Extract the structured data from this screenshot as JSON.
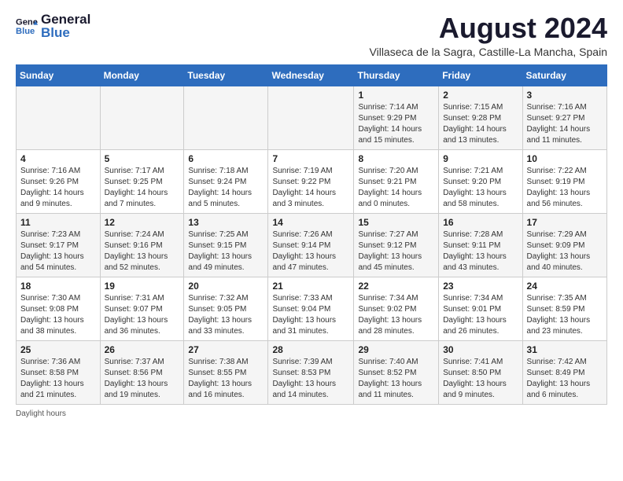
{
  "header": {
    "logo_line1": "General",
    "logo_line2": "Blue",
    "title": "August 2024",
    "subtitle": "Villaseca de la Sagra, Castille-La Mancha, Spain"
  },
  "days_of_week": [
    "Sunday",
    "Monday",
    "Tuesday",
    "Wednesday",
    "Thursday",
    "Friday",
    "Saturday"
  ],
  "footer": {
    "note": "Daylight hours"
  },
  "weeks": [
    {
      "days": [
        {
          "num": "",
          "info": ""
        },
        {
          "num": "",
          "info": ""
        },
        {
          "num": "",
          "info": ""
        },
        {
          "num": "",
          "info": ""
        },
        {
          "num": "1",
          "info": "Sunrise: 7:14 AM\nSunset: 9:29 PM\nDaylight: 14 hours\nand 15 minutes."
        },
        {
          "num": "2",
          "info": "Sunrise: 7:15 AM\nSunset: 9:28 PM\nDaylight: 14 hours\nand 13 minutes."
        },
        {
          "num": "3",
          "info": "Sunrise: 7:16 AM\nSunset: 9:27 PM\nDaylight: 14 hours\nand 11 minutes."
        }
      ]
    },
    {
      "days": [
        {
          "num": "4",
          "info": "Sunrise: 7:16 AM\nSunset: 9:26 PM\nDaylight: 14 hours\nand 9 minutes."
        },
        {
          "num": "5",
          "info": "Sunrise: 7:17 AM\nSunset: 9:25 PM\nDaylight: 14 hours\nand 7 minutes."
        },
        {
          "num": "6",
          "info": "Sunrise: 7:18 AM\nSunset: 9:24 PM\nDaylight: 14 hours\nand 5 minutes."
        },
        {
          "num": "7",
          "info": "Sunrise: 7:19 AM\nSunset: 9:22 PM\nDaylight: 14 hours\nand 3 minutes."
        },
        {
          "num": "8",
          "info": "Sunrise: 7:20 AM\nSunset: 9:21 PM\nDaylight: 14 hours\nand 0 minutes."
        },
        {
          "num": "9",
          "info": "Sunrise: 7:21 AM\nSunset: 9:20 PM\nDaylight: 13 hours\nand 58 minutes."
        },
        {
          "num": "10",
          "info": "Sunrise: 7:22 AM\nSunset: 9:19 PM\nDaylight: 13 hours\nand 56 minutes."
        }
      ]
    },
    {
      "days": [
        {
          "num": "11",
          "info": "Sunrise: 7:23 AM\nSunset: 9:17 PM\nDaylight: 13 hours\nand 54 minutes."
        },
        {
          "num": "12",
          "info": "Sunrise: 7:24 AM\nSunset: 9:16 PM\nDaylight: 13 hours\nand 52 minutes."
        },
        {
          "num": "13",
          "info": "Sunrise: 7:25 AM\nSunset: 9:15 PM\nDaylight: 13 hours\nand 49 minutes."
        },
        {
          "num": "14",
          "info": "Sunrise: 7:26 AM\nSunset: 9:14 PM\nDaylight: 13 hours\nand 47 minutes."
        },
        {
          "num": "15",
          "info": "Sunrise: 7:27 AM\nSunset: 9:12 PM\nDaylight: 13 hours\nand 45 minutes."
        },
        {
          "num": "16",
          "info": "Sunrise: 7:28 AM\nSunset: 9:11 PM\nDaylight: 13 hours\nand 43 minutes."
        },
        {
          "num": "17",
          "info": "Sunrise: 7:29 AM\nSunset: 9:09 PM\nDaylight: 13 hours\nand 40 minutes."
        }
      ]
    },
    {
      "days": [
        {
          "num": "18",
          "info": "Sunrise: 7:30 AM\nSunset: 9:08 PM\nDaylight: 13 hours\nand 38 minutes."
        },
        {
          "num": "19",
          "info": "Sunrise: 7:31 AM\nSunset: 9:07 PM\nDaylight: 13 hours\nand 36 minutes."
        },
        {
          "num": "20",
          "info": "Sunrise: 7:32 AM\nSunset: 9:05 PM\nDaylight: 13 hours\nand 33 minutes."
        },
        {
          "num": "21",
          "info": "Sunrise: 7:33 AM\nSunset: 9:04 PM\nDaylight: 13 hours\nand 31 minutes."
        },
        {
          "num": "22",
          "info": "Sunrise: 7:34 AM\nSunset: 9:02 PM\nDaylight: 13 hours\nand 28 minutes."
        },
        {
          "num": "23",
          "info": "Sunrise: 7:34 AM\nSunset: 9:01 PM\nDaylight: 13 hours\nand 26 minutes."
        },
        {
          "num": "24",
          "info": "Sunrise: 7:35 AM\nSunset: 8:59 PM\nDaylight: 13 hours\nand 23 minutes."
        }
      ]
    },
    {
      "days": [
        {
          "num": "25",
          "info": "Sunrise: 7:36 AM\nSunset: 8:58 PM\nDaylight: 13 hours\nand 21 minutes."
        },
        {
          "num": "26",
          "info": "Sunrise: 7:37 AM\nSunset: 8:56 PM\nDaylight: 13 hours\nand 19 minutes."
        },
        {
          "num": "27",
          "info": "Sunrise: 7:38 AM\nSunset: 8:55 PM\nDaylight: 13 hours\nand 16 minutes."
        },
        {
          "num": "28",
          "info": "Sunrise: 7:39 AM\nSunset: 8:53 PM\nDaylight: 13 hours\nand 14 minutes."
        },
        {
          "num": "29",
          "info": "Sunrise: 7:40 AM\nSunset: 8:52 PM\nDaylight: 13 hours\nand 11 minutes."
        },
        {
          "num": "30",
          "info": "Sunrise: 7:41 AM\nSunset: 8:50 PM\nDaylight: 13 hours\nand 9 minutes."
        },
        {
          "num": "31",
          "info": "Sunrise: 7:42 AM\nSunset: 8:49 PM\nDaylight: 13 hours\nand 6 minutes."
        }
      ]
    }
  ]
}
